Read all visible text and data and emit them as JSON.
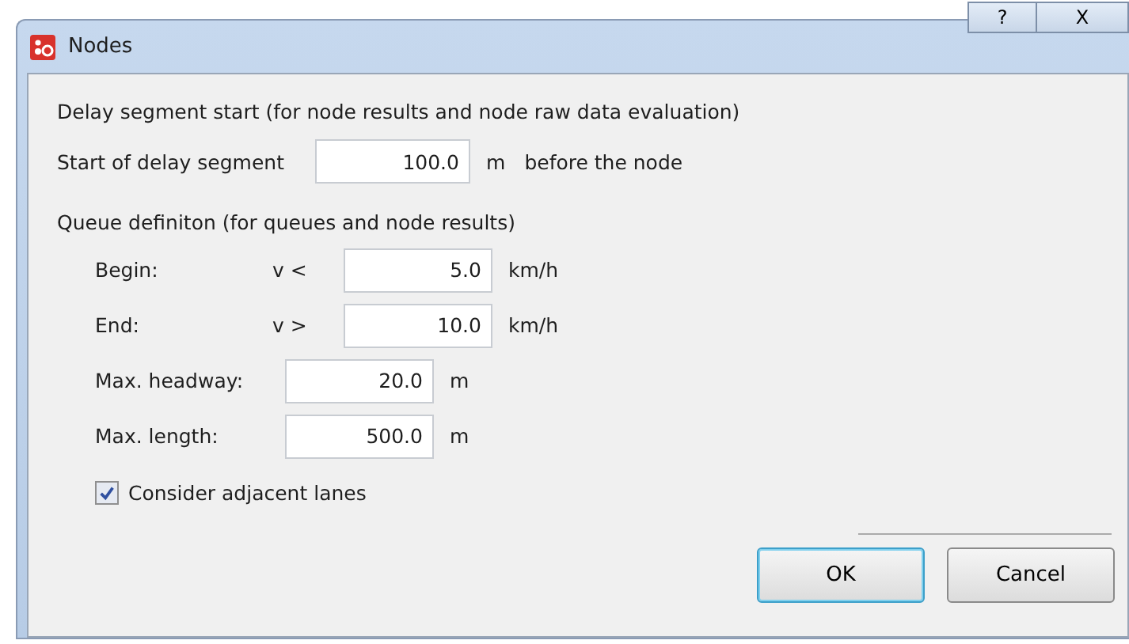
{
  "window": {
    "title": "Nodes",
    "help_button": "?",
    "close_button": "X"
  },
  "delay": {
    "heading": "Delay segment start (for node results and node raw data evaluation)",
    "label": "Start of delay segment",
    "value": "100.0",
    "unit": "m",
    "suffix": "before the node"
  },
  "queue": {
    "heading": "Queue definiton (for queues and node results)",
    "rows": [
      {
        "kind": "speed",
        "label": "Begin:",
        "operator": "v <",
        "value": "5.0",
        "unit": "km/h"
      },
      {
        "kind": "speed",
        "label": "End:",
        "operator": "v >",
        "value": "10.0",
        "unit": "km/h"
      },
      {
        "kind": "plain",
        "label": "Max. headway:",
        "value": "20.0",
        "unit": "m"
      },
      {
        "kind": "plain",
        "label": "Max. length:",
        "value": "500.0",
        "unit": "m"
      }
    ],
    "adjacent": {
      "label": "Consider adjacent lanes",
      "checked": true
    }
  },
  "buttons": [
    {
      "label": "OK",
      "default": true
    },
    {
      "label": "Cancel",
      "default": false
    }
  ]
}
